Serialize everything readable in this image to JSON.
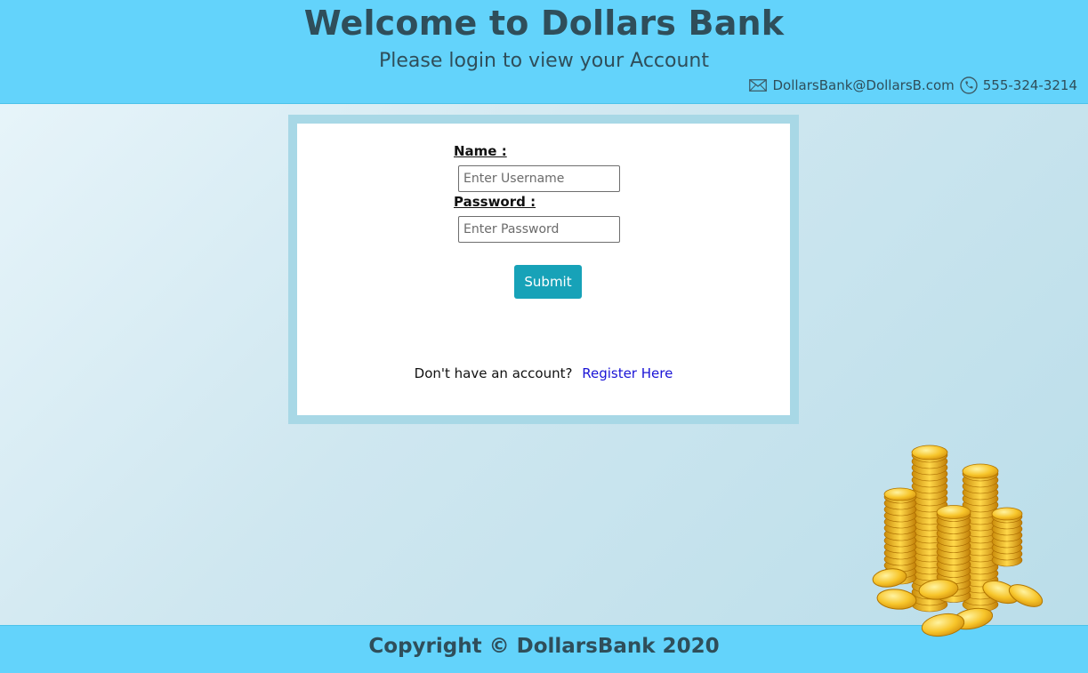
{
  "header": {
    "title": "Welcome to Dollars Bank",
    "subtitle": "Please login to view your Account",
    "email": "DollarsBank@DollarsB.com",
    "phone": "555-324-3214"
  },
  "login": {
    "name_label": "Name :",
    "username_placeholder": "Enter Username",
    "password_label": "Password :",
    "password_placeholder": "Enter Password",
    "submit_label": "Submit",
    "no_account_text": "Don't have an account?",
    "register_link": "Register Here"
  },
  "footer": {
    "copyright": "Copyright © DollarsBank 2020"
  },
  "colors": {
    "header_bg": "#63d3fb",
    "title_text": "#2f4e5a",
    "card_border": "#a8d8e6",
    "submit_bg": "#17a2b8",
    "link": "#1a14d6"
  },
  "icons": {
    "email": "envelope-icon",
    "phone": "phone-icon",
    "decoration": "gold-coins-illustration"
  }
}
